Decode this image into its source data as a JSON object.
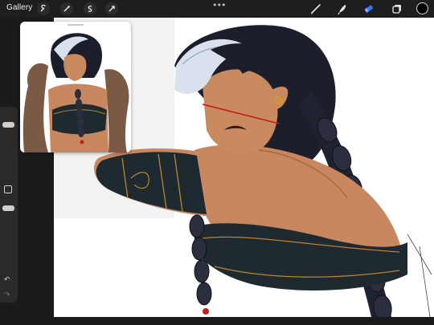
{
  "toolbar": {
    "gallery_label": "Gallery",
    "left_tools": [
      "wrench-icon",
      "magic-wand-icon",
      "selection-icon",
      "move-icon"
    ],
    "more": "•••",
    "right_tools": [
      "brush-icon",
      "smudge-icon",
      "eraser-icon",
      "layers-icon"
    ],
    "active_tool": "eraser-icon",
    "current_color": "#000000",
    "accent": "#2e79ff"
  },
  "sidebar": {
    "size_slider_value": 0.1,
    "opacity_slider_value": 0.85,
    "undo": "↶",
    "redo": "↷"
  },
  "reference": {
    "grab_handle": "reference-grab-handle"
  }
}
